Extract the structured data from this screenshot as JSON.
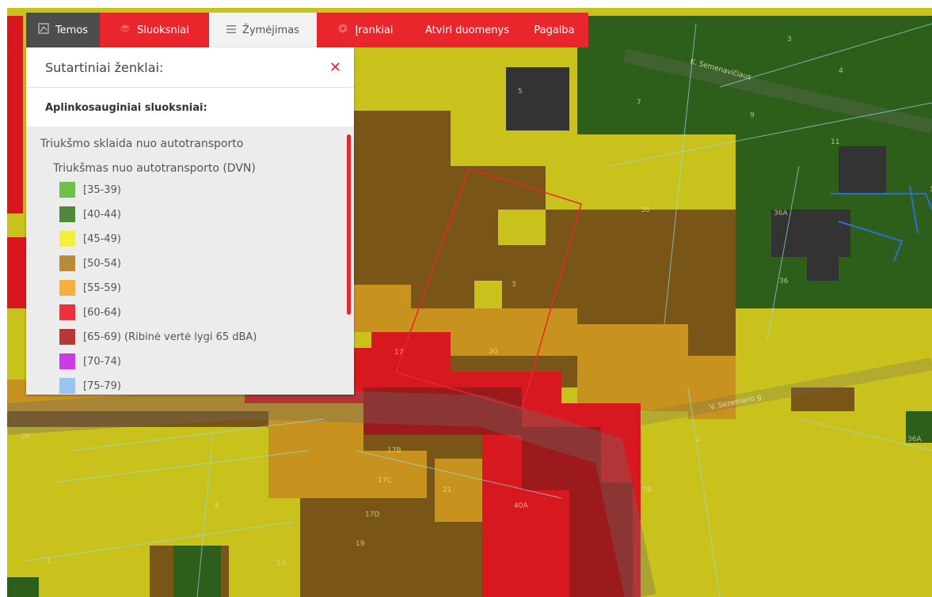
{
  "tabs": [
    {
      "label": "Temos",
      "icon": "map-icon",
      "style": "dark"
    },
    {
      "label": "Sluoksniai",
      "icon": "layers-icon",
      "style": "red"
    },
    {
      "label": "Žymėjimas",
      "icon": "hamburger-icon",
      "style": "active"
    },
    {
      "label": "Įrankiai",
      "icon": "tools-icon",
      "style": "red"
    },
    {
      "label": "Atviri duomenys",
      "icon": "",
      "style": "red"
    },
    {
      "label": "Pagalba",
      "icon": "",
      "style": "red"
    }
  ],
  "legend": {
    "panel_title": "Sutartiniai ženklai:",
    "close_icon": "close-icon",
    "section_title": "Aplinkosauginiai sluoksniai:",
    "group_title": "Triukšmo sklaida nuo autotransporto",
    "layer_title": "Triukšmas nuo autotransporto (DVN)",
    "items": [
      {
        "label": "[35-39)",
        "color": "#6cc24a"
      },
      {
        "label": "[40-44)",
        "color": "#4e8a3c"
      },
      {
        "label": "[45-49)",
        "color": "#f5f03a"
      },
      {
        "label": "[50-54)",
        "color": "#b88a3a"
      },
      {
        "label": "[55-59)",
        "color": "#f5b040"
      },
      {
        "label": "[60-64)",
        "color": "#f0303a"
      },
      {
        "label": "[65-69) (Ribinė vertė lygi 65 dBA)",
        "color": "#b83838"
      },
      {
        "label": "[70-74)",
        "color": "#cc3ae8"
      },
      {
        "label": "[75-79)",
        "color": "#9ac4f0"
      }
    ]
  },
  "map": {
    "colors": {
      "yellow": "#c9c11c",
      "brown": "#7a5518",
      "orange": "#c8921e",
      "red": "#d7191f",
      "darkred": "#9c1a1c",
      "green": "#2d5e1a",
      "dark": "#333333",
      "road": "#6e6a64",
      "selection": "#e8262c",
      "building_line": "#8fe0e6",
      "parcel_line": "#2a6fd6"
    },
    "street_labels": [
      "K. Semenavičiaus",
      "V. Sezemano g."
    ],
    "building_labels": [
      "3",
      "5",
      "4",
      "7",
      "9",
      "11",
      "13",
      "36A",
      "36",
      "38",
      "17",
      "17B",
      "17C",
      "17D",
      "19",
      "21",
      "40A",
      "7B",
      "7F",
      "1",
      "2",
      "36A",
      "30",
      "3",
      "9",
      "13"
    ]
  }
}
